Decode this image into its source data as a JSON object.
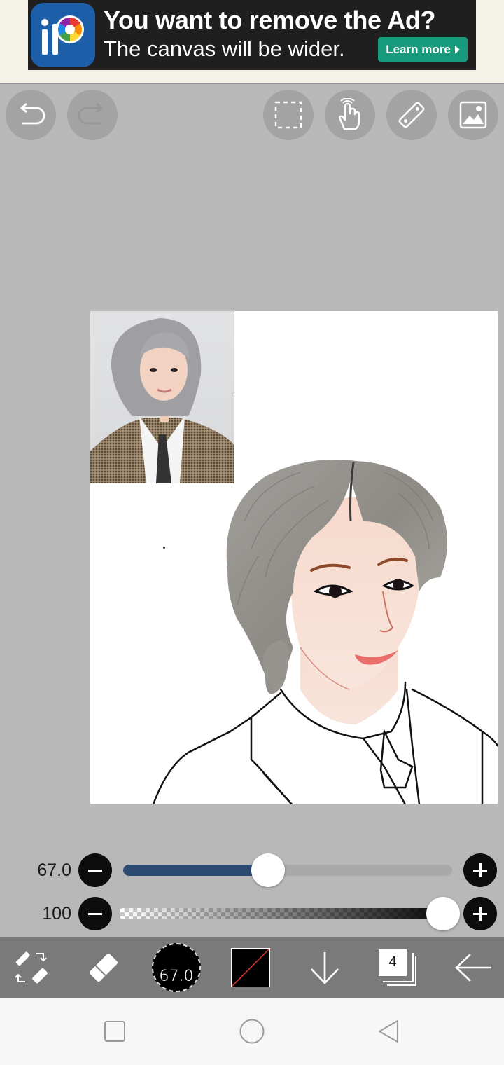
{
  "ad": {
    "title": "You want to remove the Ad?",
    "subtitle": "The canvas will be wider.",
    "learn_more": "Learn more"
  },
  "top_tools": [
    {
      "name": "undo",
      "icon": "undo-icon",
      "enabled": true
    },
    {
      "name": "redo",
      "icon": "redo-icon",
      "enabled": false
    },
    {
      "name": "selection",
      "icon": "selection-icon",
      "enabled": true
    },
    {
      "name": "hand",
      "icon": "hand-icon",
      "enabled": true
    },
    {
      "name": "ruler",
      "icon": "ruler-icon",
      "enabled": true
    },
    {
      "name": "image",
      "icon": "image-icon",
      "enabled": true
    }
  ],
  "brush": {
    "size_label": "67.0",
    "size_value": 67.0,
    "size_fraction": 0.44,
    "opacity_label": "100",
    "opacity_value": 100
  },
  "toolbar": {
    "brush_size_text": "67.0",
    "color": "#000000",
    "layers_count": "4"
  },
  "colors": {
    "accent_ad": "#179b7c",
    "slider_fill": "#2d4a70"
  }
}
